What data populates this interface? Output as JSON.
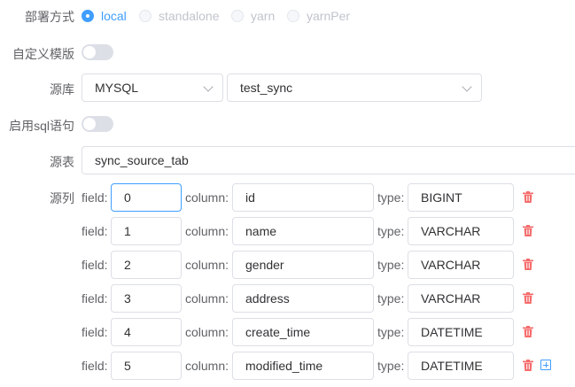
{
  "deploy": {
    "label": "部署方式",
    "options": [
      {
        "label": "local",
        "checked": true,
        "disabled": false
      },
      {
        "label": "standalone",
        "checked": false,
        "disabled": true
      },
      {
        "label": "yarn",
        "checked": false,
        "disabled": true
      },
      {
        "label": "yarnPer",
        "checked": false,
        "disabled": true
      }
    ]
  },
  "custom_template": {
    "label": "自定义模版",
    "enabled": false
  },
  "source_db": {
    "label": "源库",
    "type_value": "MYSQL",
    "db_value": "test_sync"
  },
  "enable_sql": {
    "label": "启用sql语句",
    "enabled": false
  },
  "source_table": {
    "label": "源表",
    "value": "sync_source_tab"
  },
  "source_columns": {
    "label": "源列",
    "field_label": "field:",
    "column_label": "column:",
    "type_label": "type:",
    "rows": [
      {
        "field": "0",
        "column": "id",
        "type": "BIGINT"
      },
      {
        "field": "1",
        "column": "name",
        "type": "VARCHAR"
      },
      {
        "field": "2",
        "column": "gender",
        "type": "VARCHAR"
      },
      {
        "field": "3",
        "column": "address",
        "type": "VARCHAR"
      },
      {
        "field": "4",
        "column": "create_time",
        "type": "DATETIME"
      },
      {
        "field": "5",
        "column": "modified_time",
        "type": "DATETIME"
      }
    ]
  },
  "colors": {
    "primary": "#409eff",
    "danger": "#f56c6c",
    "text": "#606266",
    "border": "#dcdfe6"
  }
}
